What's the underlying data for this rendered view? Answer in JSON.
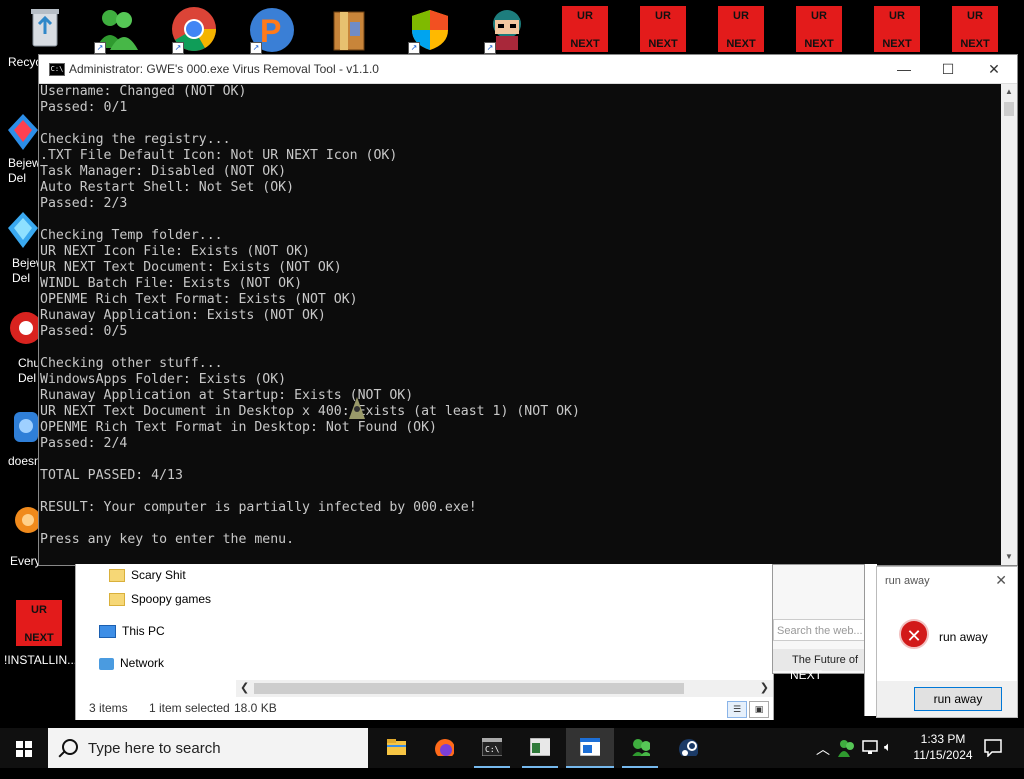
{
  "desktop": {
    "icons_left": [
      {
        "label": "Recycl",
        "icon": "recycle-bin-icon"
      },
      {
        "label": "Bejew Del",
        "icon": "bejeweled-icon"
      },
      {
        "label": "Bejew Del",
        "icon": "bejeweled-icon"
      },
      {
        "label": "Chu Del",
        "icon": "chuzzle-icon"
      },
      {
        "label": "doesn",
        "icon": "app-icon"
      },
      {
        "label": "Every...",
        "icon": "everything-icon"
      },
      {
        "label": "!INSTALLIN...",
        "icon": "ur-next-icon"
      }
    ],
    "urnext_tile": {
      "line1": "UR",
      "line2": "NEXT"
    },
    "browser_tile_label": "NEXT"
  },
  "console": {
    "title": "Administrator:  GWE's 000.exe Virus Removal Tool - v1.1.0",
    "lines": [
      "Username: Changed (NOT OK)",
      "Passed: 0/1",
      "",
      "Checking the registry...",
      ".TXT File Default Icon: Not UR NEXT Icon (OK)",
      "Task Manager: Disabled (NOT OK)",
      "Auto Restart Shell: Not Set (OK)",
      "Passed: 2/3",
      "",
      "Checking Temp folder...",
      "UR NEXT Icon File: Exists (NOT OK)",
      "UR NEXT Text Document: Exists (NOT OK)",
      "WINDL Batch File: Exists (NOT OK)",
      "OPENME Rich Text Format: Exists (NOT OK)",
      "Runaway Application: Exists (NOT OK)",
      "Passed: 0/5",
      "",
      "Checking other stuff...",
      "WindowsApps Folder: Exists (OK)",
      "Runaway Application at Startup: Exists (NOT OK)",
      "UR NEXT Text Document in Desktop x 400: Exists (at least 1) (NOT OK)",
      "OPENME Rich Text Format in Desktop: Not Found (OK)",
      "Passed: 2/4",
      "",
      "TOTAL PASSED: 4/13",
      "",
      "RESULT: Your computer is partially infected by 000.exe!",
      "",
      "Press any key to enter the menu."
    ]
  },
  "explorer": {
    "nav": [
      "Scary Shit",
      "Spoopy games",
      "This PC",
      "Network"
    ],
    "status_items": "3 items",
    "status_selected": "1 item selected",
    "status_size": "18.0 KB"
  },
  "browser": {
    "search_placeholder": "Search the web...",
    "tab_title": "The Future of"
  },
  "dialog": {
    "title": "run away",
    "message": "run away",
    "button": "run away"
  },
  "taskbar": {
    "search_placeholder": "Type here to search",
    "time": "1:33 PM",
    "date": "11/15/2024"
  }
}
